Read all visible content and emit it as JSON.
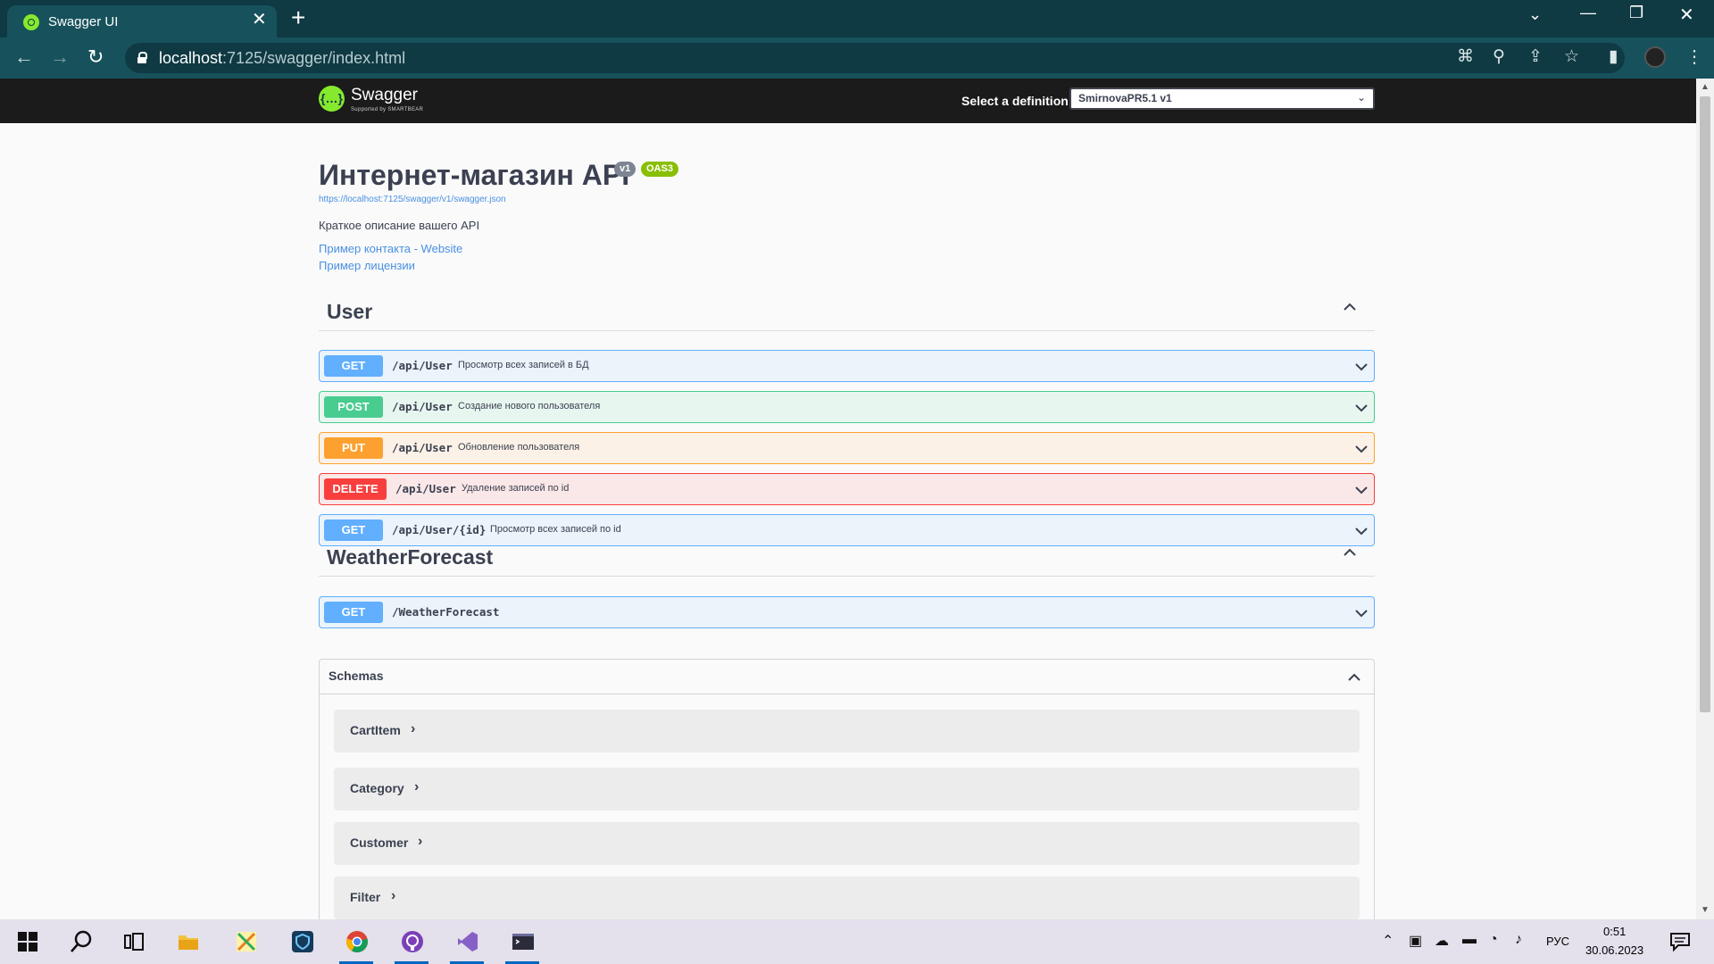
{
  "browser": {
    "tab_title": "Swagger UI",
    "url_host": "localhost",
    "url_path": ":7125/swagger/index.html"
  },
  "swagger": {
    "logo_text": "Swagger",
    "logo_sub": "Supported by SMARTBEAR",
    "select_label": "Select a definition",
    "selected_definition": "SmirnovaPR5.1 v1"
  },
  "info": {
    "title": "Интернет-магазин API",
    "version_badge": "v1",
    "oas_badge": "OAS3",
    "spec_url": "https://localhost:7125/swagger/v1/swagger.json",
    "description": "Краткое описание вашего API",
    "contact_link": "Пример контакта - Website",
    "license_link": "Пример лицензии"
  },
  "tags": [
    {
      "name": "User",
      "operations": [
        {
          "method": "GET",
          "path": "/api/User",
          "summary": "Просмотр всех записей в БД"
        },
        {
          "method": "POST",
          "path": "/api/User",
          "summary": "Создание нового пользователя"
        },
        {
          "method": "PUT",
          "path": "/api/User",
          "summary": "Обновление пользователя"
        },
        {
          "method": "DELETE",
          "path": "/api/User",
          "summary": "Удаление записей по id"
        },
        {
          "method": "GET",
          "path": "/api/User/{id}",
          "summary": "Просмотр всех записей по id"
        }
      ]
    },
    {
      "name": "WeatherForecast",
      "operations": [
        {
          "method": "GET",
          "path": "/WeatherForecast",
          "summary": ""
        }
      ]
    }
  ],
  "schemas": {
    "title": "Schemas",
    "models": [
      "CartItem",
      "Category",
      "Customer",
      "Filter"
    ]
  },
  "taskbar": {
    "language": "РУС",
    "time": "0:51",
    "date": "30.06.2023"
  },
  "colors": {
    "get": "#61affe",
    "post": "#49cc90",
    "put": "#fca130",
    "delete": "#f93e3e",
    "swagger_green": "#85ea2d",
    "browser_frame": "#17525c"
  }
}
